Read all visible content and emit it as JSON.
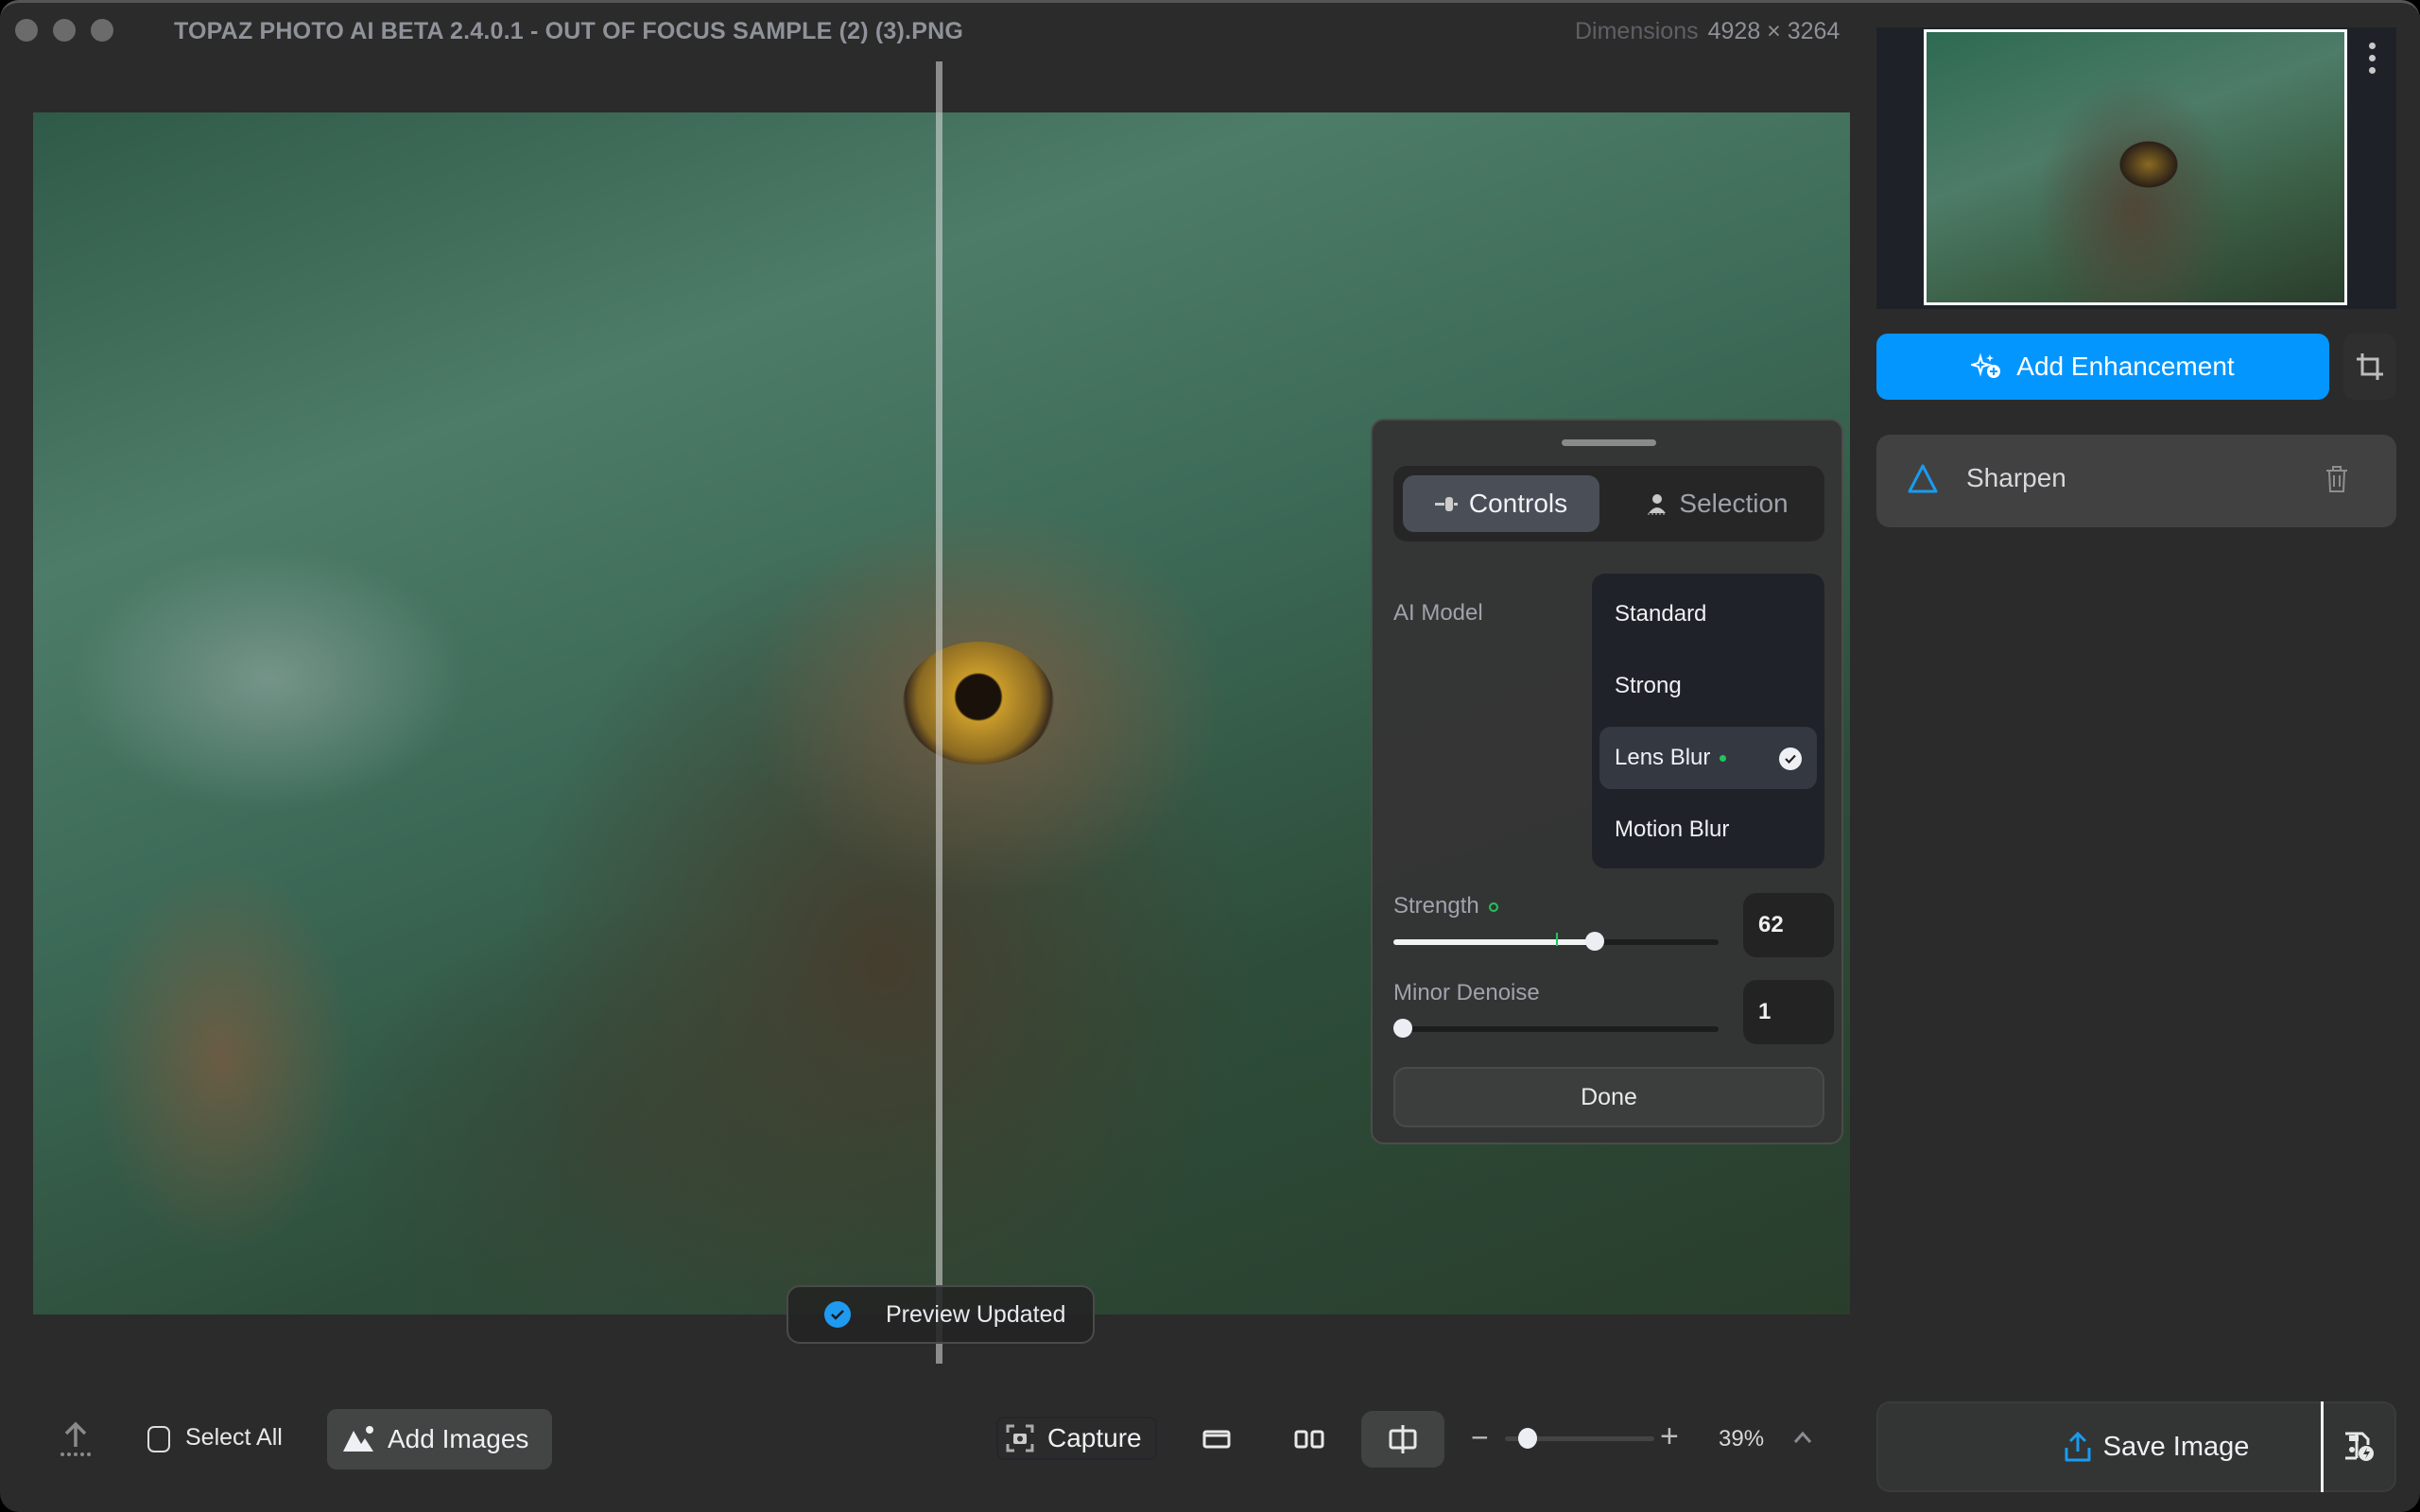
{
  "window": {
    "title": "TOPAZ PHOTO AI BETA 2.4.0.1 - OUT OF FOCUS SAMPLE (2) (3).PNG",
    "dimensions_label": "Dimensions",
    "dimensions_value": "4928 × 3264"
  },
  "canvas": {
    "toast": "Preview Updated"
  },
  "panel": {
    "tabs": [
      {
        "label": "Controls",
        "icon": "slider-icon",
        "active": true
      },
      {
        "label": "Selection",
        "icon": "person-selection-icon",
        "active": false
      }
    ],
    "ai_model_label": "AI Model",
    "models": [
      {
        "label": "Standard",
        "selected": false
      },
      {
        "label": "Strong",
        "selected": false
      },
      {
        "label": "Lens Blur",
        "selected": true,
        "recommended": true
      },
      {
        "label": "Motion Blur",
        "selected": false
      }
    ],
    "strength": {
      "label": "Strength",
      "value": "62",
      "fraction": 0.62,
      "default_fraction": 0.5
    },
    "minor_denoise": {
      "label": "Minor Denoise",
      "value": "1",
      "fraction": 0.01
    },
    "done_label": "Done"
  },
  "sidebar": {
    "add_enhancement_label": "Add Enhancement",
    "enhancements": [
      {
        "label": "Sharpen",
        "icon": "triangle-icon"
      }
    ]
  },
  "bottom": {
    "select_all_label": "Select All",
    "add_images_label": "Add Images",
    "capture_label": "Capture",
    "zoom_percent": "39%",
    "zoom_fraction": 0.15,
    "save_label": "Save Image"
  },
  "colors": {
    "accent": "#0496ff",
    "recommended": "#21c55d",
    "background": "#2b2b2b"
  }
}
